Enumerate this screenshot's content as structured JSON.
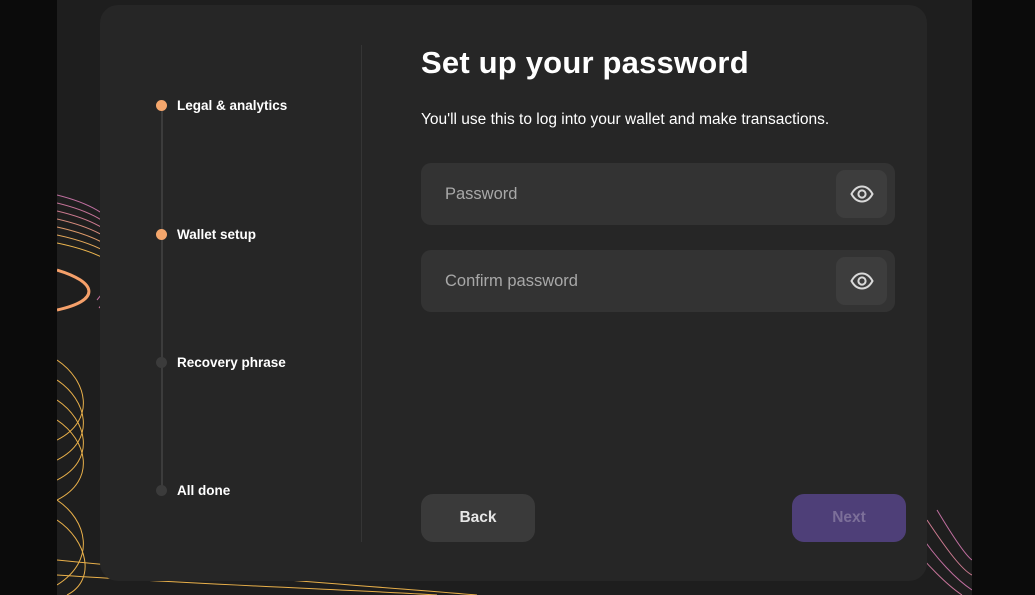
{
  "stepper": {
    "steps": [
      {
        "label": "Legal & analytics",
        "state": "complete"
      },
      {
        "label": "Wallet setup",
        "state": "current"
      },
      {
        "label": "Recovery phrase",
        "state": "pending"
      },
      {
        "label": "All done",
        "state": "pending"
      }
    ]
  },
  "main": {
    "title": "Set up your password",
    "subtitle": "You'll use this to log into your wallet and make transactions.",
    "password_field": {
      "placeholder": "Password",
      "value": "",
      "toggle_icon": "eye-icon"
    },
    "confirm_field": {
      "placeholder": "Confirm password",
      "value": "",
      "toggle_icon": "eye-icon"
    }
  },
  "footer": {
    "back_label": "Back",
    "next_label": "Next",
    "next_disabled": true
  },
  "colors": {
    "accent_dot": "#f4a66c",
    "card_bg": "#262626",
    "field_bg": "#333333",
    "next_disabled_bg": "#4e3f78"
  }
}
